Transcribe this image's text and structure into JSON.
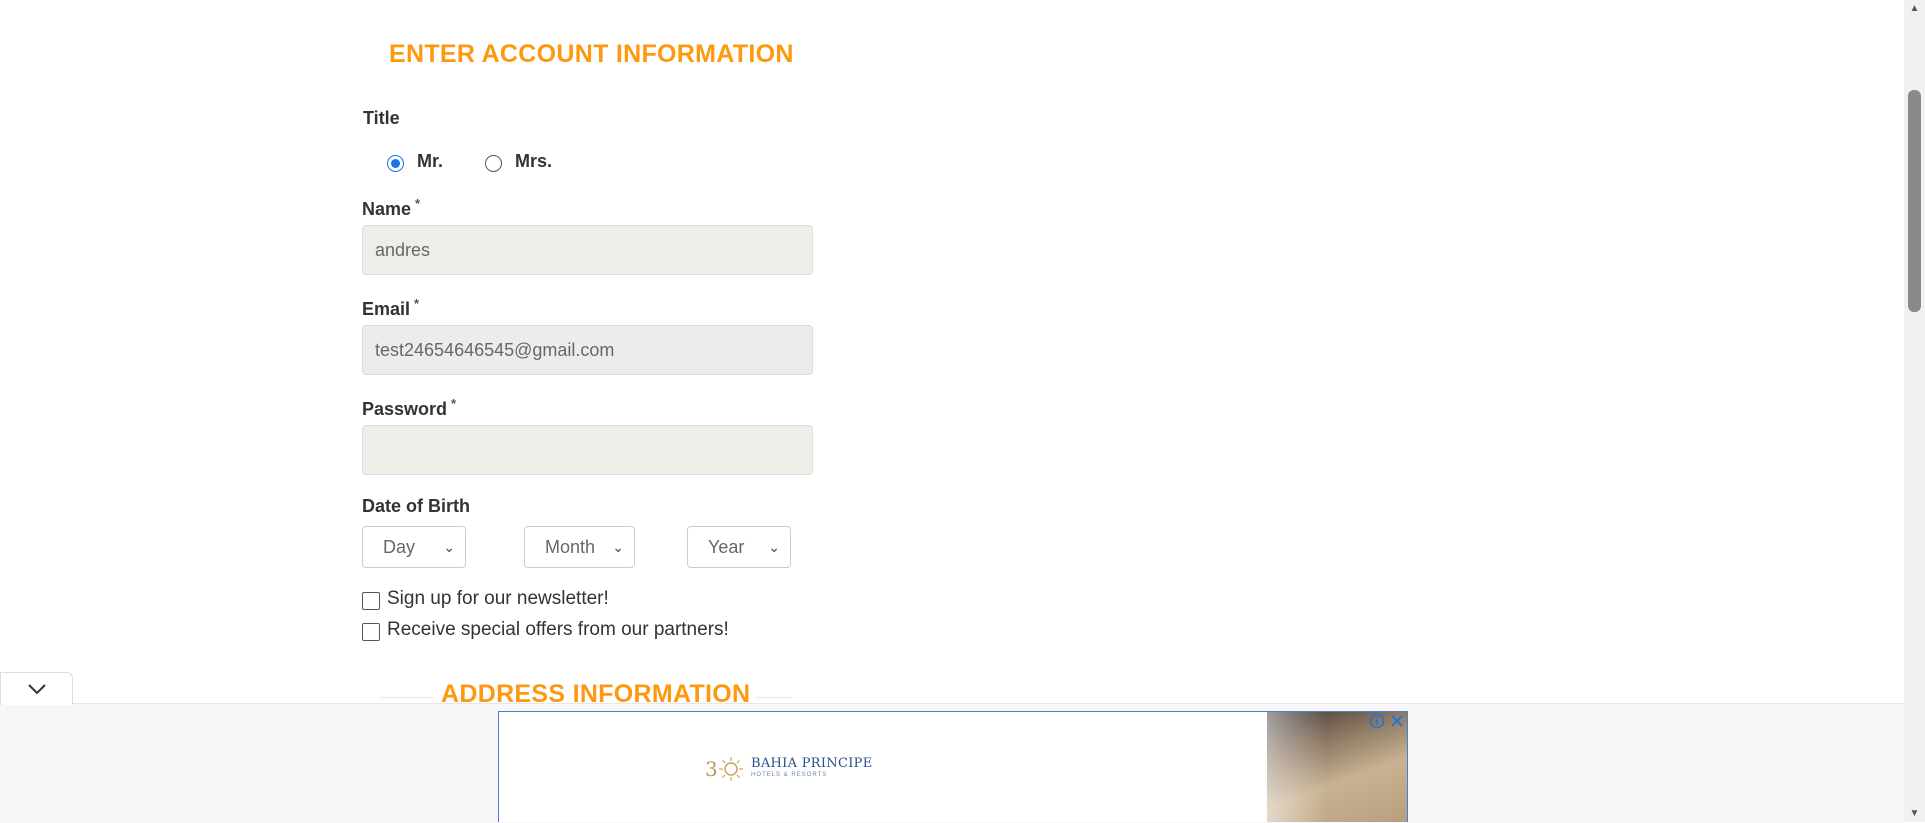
{
  "form": {
    "heading": "ENTER ACCOUNT INFORMATION",
    "title_label": "Title",
    "title_options": [
      {
        "label": "Mr.",
        "selected": true
      },
      {
        "label": "Mrs.",
        "selected": false
      }
    ],
    "name": {
      "label": "Name",
      "required_mark": "*",
      "value": "andres"
    },
    "email": {
      "label": "Email",
      "required_mark": "*",
      "value": "test24654646545@gmail.com"
    },
    "password": {
      "label": "Password",
      "required_mark": "*",
      "value": ""
    },
    "dob": {
      "label": "Date of Birth",
      "day": "Day",
      "month": "Month",
      "year": "Year"
    },
    "newsletter": {
      "label": "Sign up for our newsletter!",
      "checked": false
    },
    "offers": {
      "label": "Receive special offers from our partners!",
      "checked": false
    }
  },
  "address": {
    "heading": "ADDRESS INFORMATION"
  },
  "ad": {
    "brand": "BAHIA PRINCIPE",
    "brand_sub": "HOTELS & RESORTS",
    "logo_icon": "sun-logo-icon",
    "info_icon": "info-icon",
    "close_icon": "close-icon"
  },
  "collapse_icon": "chevron-down-icon",
  "colors": {
    "heading": "#fe980f",
    "input_beige": "#eeeee8",
    "input_gray": "#ececec",
    "radio_selected": "#1a73e8",
    "ad_border": "#4a7fd4"
  }
}
